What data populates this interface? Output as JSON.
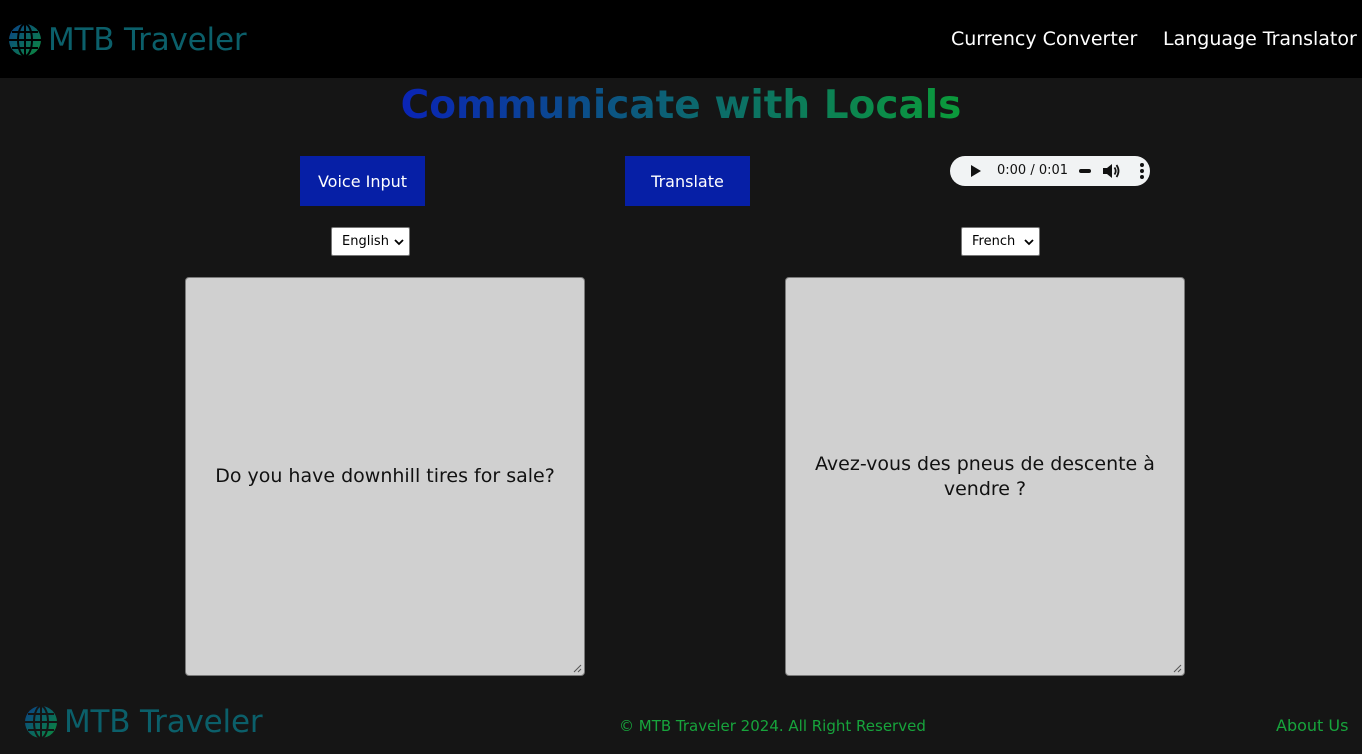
{
  "brand": {
    "name": "MTB Traveler",
    "color": "#0b5f6a",
    "icon": "globe-icon"
  },
  "nav": {
    "currency": "Currency Converter",
    "language": "Language Translator"
  },
  "heading": "Communicate with Locals",
  "buttons": {
    "voice": "Voice Input",
    "translate": "Translate"
  },
  "audio": {
    "time": "0:00 / 0:01"
  },
  "source_language": {
    "selected": "English"
  },
  "target_language": {
    "selected": "French"
  },
  "input_text": "Do you have downhill tires for sale?",
  "output_text": "Avez-vous des pneus de descente à vendre ?",
  "footer": {
    "copyright": "© MTB Traveler 2024. All Right Reserved",
    "about": "About Us"
  },
  "colors": {
    "accent_blue": "#061fa6",
    "green": "#17a43c",
    "background": "#151515",
    "topbar": "#000000"
  }
}
